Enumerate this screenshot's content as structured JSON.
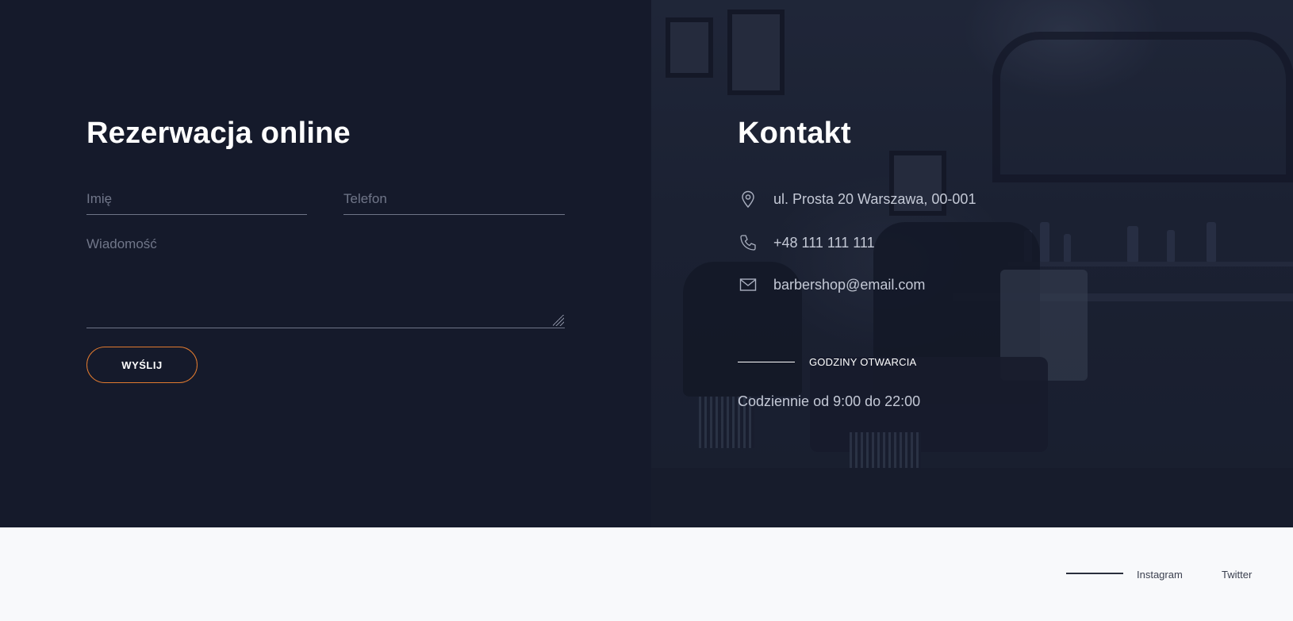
{
  "booking": {
    "title": "Rezerwacja online",
    "name_placeholder": "Imię",
    "phone_placeholder": "Telefon",
    "message_placeholder": "Wiadomość",
    "submit_label": "WYŚLIJ"
  },
  "contact": {
    "title": "Kontakt",
    "items": [
      {
        "icon": "location-pin-icon",
        "text": "ul. Prosta 20 Warszawa, 00-001"
      },
      {
        "icon": "phone-icon",
        "text": "+48 111 111 111"
      },
      {
        "icon": "envelope-icon",
        "text": "barbershop@email.com"
      }
    ],
    "hours_label": "GODZINY OTWARCIA",
    "hours_text": "Codziennie od 9:00 do 22:00"
  },
  "footer": {
    "links": [
      "Instagram",
      "Twitter"
    ]
  },
  "colors": {
    "dark_bg": "#151a2b",
    "accent": "#e07a2f",
    "footer_bg": "#f8f9fb"
  }
}
